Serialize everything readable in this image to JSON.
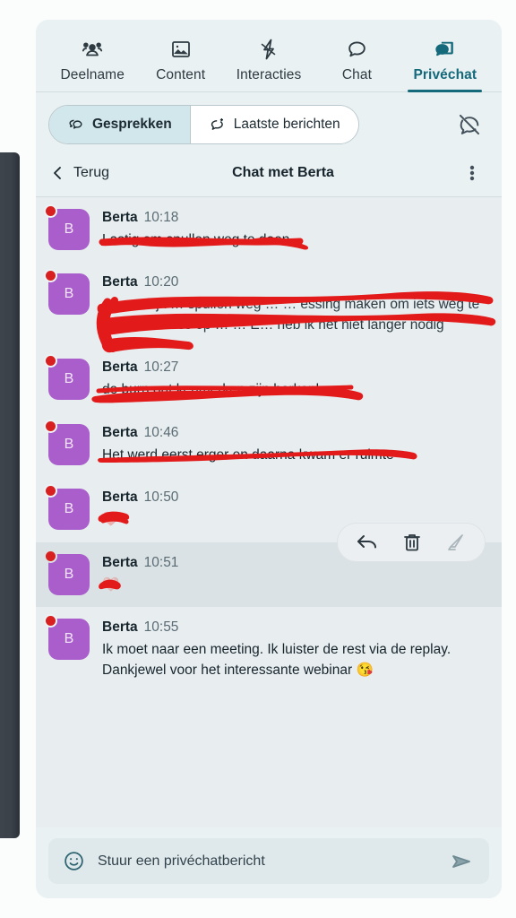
{
  "colors": {
    "accent_teal": "#14697a",
    "panel_bg": "#eaf1f3",
    "chat_bg": "#e8eef0",
    "hover_row": "#dbe2e5",
    "avatar_purple": "#a95ecb",
    "badge_red": "#d92020",
    "redaction_red": "#e31a1a"
  },
  "tabs": [
    {
      "label": "Deelname",
      "icon": "people-group-icon",
      "active": false
    },
    {
      "label": "Content",
      "icon": "image-icon",
      "active": false
    },
    {
      "label": "Interacties",
      "icon": "lightning-bolt-icon",
      "active": false
    },
    {
      "label": "Chat",
      "icon": "speech-bubble-icon",
      "active": false
    },
    {
      "label": "Privéchat",
      "icon": "private-chat-icon",
      "active": true
    }
  ],
  "segmented": {
    "items": [
      {
        "label": "Gesprekken",
        "icon": "chats-icon",
        "active": true
      },
      {
        "label": "Laatste berichten",
        "icon": "new-message-icon",
        "active": false
      }
    ],
    "mute_icon": "notifications-off-icon"
  },
  "conversation_header": {
    "back_label": "Terug",
    "back_icon": "chevron-left-icon",
    "title": "Chat met Berta",
    "menu_icon": "kebab-menu-icon"
  },
  "messages": [
    {
      "avatar_initial": "B",
      "sender": "Berta",
      "time": "10:18",
      "text": "Lastig om spullen weg te doen",
      "redacted": true,
      "hovered": false
    },
    {
      "avatar_initial": "B",
      "sender": "Berta",
      "time": "10:20",
      "text": "… moeilijk … spullen weg … … essing maken om iets weg te doen … stress op … … E… heb ik het niet langer nodig",
      "redacted": true,
      "hovered": false
    },
    {
      "avatar_initial": "B",
      "sender": "Berta",
      "time": "10:27",
      "text": "de burn out kenmerken zijn herkenbaar",
      "redacted": true,
      "hovered": false
    },
    {
      "avatar_initial": "B",
      "sender": "Berta",
      "time": "10:46",
      "text": "Het werd eerst erger en daarna kwam er ruimte",
      "redacted": true,
      "hovered": false
    },
    {
      "avatar_initial": "B",
      "sender": "Berta",
      "time": "10:50",
      "text": "❤️",
      "redacted": true,
      "hovered": false
    },
    {
      "avatar_initial": "B",
      "sender": "Berta",
      "time": "10:51",
      "text": "❤️",
      "redacted": true,
      "hovered": true
    },
    {
      "avatar_initial": "B",
      "sender": "Berta",
      "time": "10:55",
      "text": "Ik moet naar een meeting. Ik luister de rest via de replay. Dankjewel voor het interessante webinar 😘",
      "redacted": false,
      "hovered": false
    }
  ],
  "hover_actions": [
    {
      "name": "reply-icon",
      "label": "Beantwoorden"
    },
    {
      "name": "trash-icon",
      "label": "Verwijderen"
    },
    {
      "name": "highlight-icon",
      "label": "Markeren"
    }
  ],
  "composer": {
    "emoji_icon": "smiley-icon",
    "placeholder": "Stuur een privéchatbericht",
    "value": "",
    "send_icon": "send-icon"
  }
}
